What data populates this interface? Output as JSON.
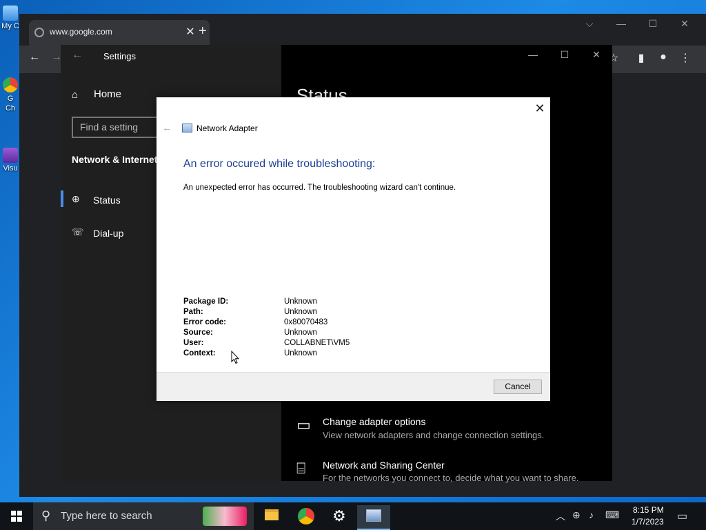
{
  "desktop": {
    "icons": [
      {
        "label": "My C"
      },
      {
        "label": "G Ch"
      },
      {
        "label": "Visu"
      }
    ]
  },
  "chrome": {
    "tab_title": "www.google.com",
    "new_tab": "+",
    "close": "✕"
  },
  "settings": {
    "title": "Settings",
    "home": "Home",
    "search_placeholder": "Find a setting",
    "section": "Network & Internet",
    "nav": [
      {
        "label": "Status",
        "selected": true
      },
      {
        "label": "Dial-up",
        "selected": false
      }
    ],
    "page_heading": "Status",
    "options": [
      {
        "title": "Change adapter options",
        "desc": "View network adapters and change connection settings."
      },
      {
        "title": "Network and Sharing Center",
        "desc": "For the networks you connect to, decide what you want to share."
      }
    ]
  },
  "dialog": {
    "app_title": "Network Adapter",
    "heading": "An error occured while troubleshooting:",
    "message": "An unexpected error has occurred. The troubleshooting wizard can't continue.",
    "details": [
      {
        "key": "Package ID:",
        "value": "Unknown"
      },
      {
        "key": "Path:",
        "value": "Unknown"
      },
      {
        "key": "Error code:",
        "value": "0x80070483"
      },
      {
        "key": "Source:",
        "value": "Unknown"
      },
      {
        "key": "User:",
        "value": "COLLABNET\\VM5"
      },
      {
        "key": "Context:",
        "value": "Unknown"
      }
    ],
    "cancel_label": "Cancel"
  },
  "taskbar": {
    "search_placeholder": "Type here to search",
    "time": "8:15 PM",
    "date": "1/7/2023"
  },
  "colors": {
    "accent": "#4a8ce8",
    "dialog_heading": "#1c3f94"
  }
}
